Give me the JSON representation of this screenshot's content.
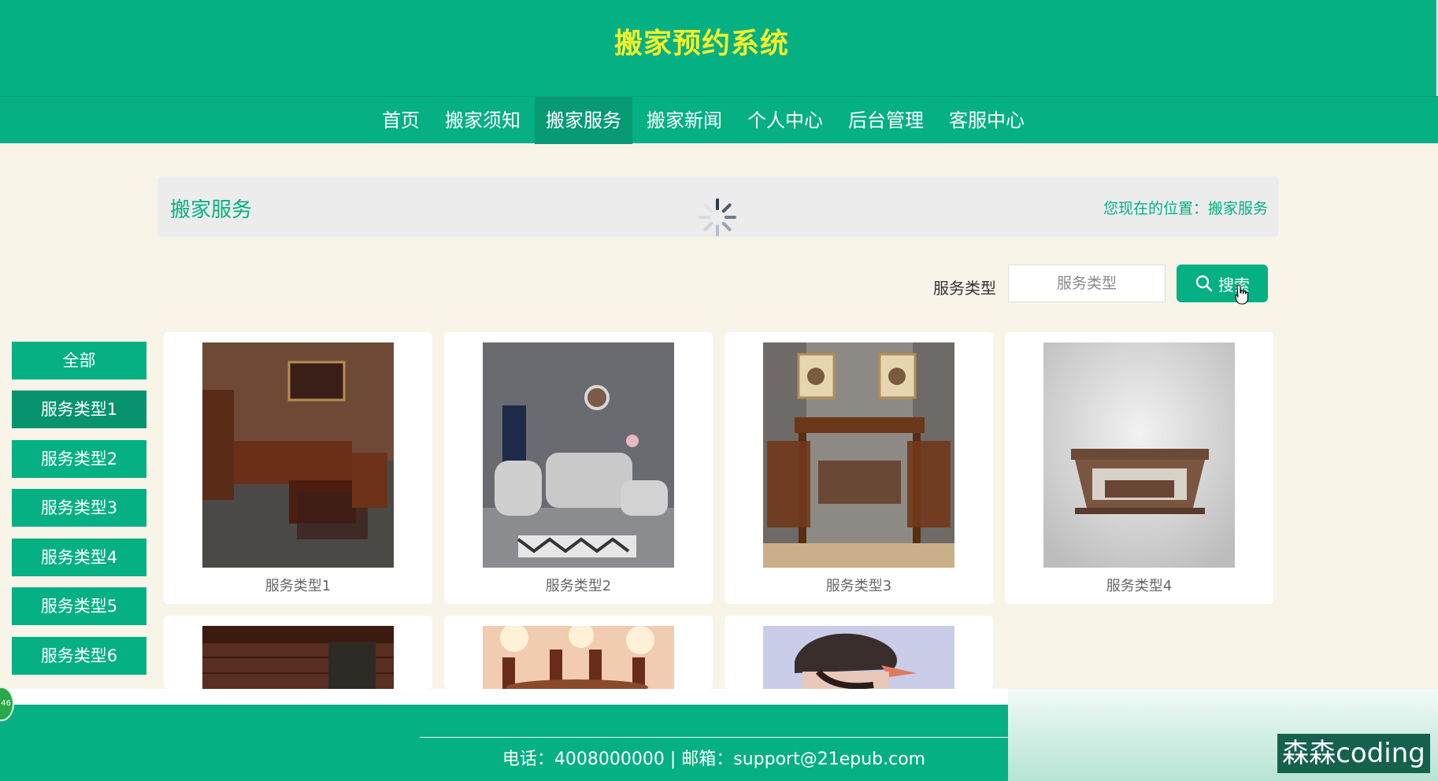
{
  "header": {
    "title": "搬家预约系统"
  },
  "nav": {
    "items": [
      {
        "label": "首页"
      },
      {
        "label": "搬家须知"
      },
      {
        "label": "搬家服务",
        "active": true
      },
      {
        "label": "搬家新闻"
      },
      {
        "label": "个人中心"
      },
      {
        "label": "后台管理"
      },
      {
        "label": "客服中心"
      }
    ]
  },
  "page": {
    "title": "搬家服务",
    "breadcrumb": "您现在的位置：搬家服务"
  },
  "search": {
    "label": "服务类型",
    "placeholder": "服务类型",
    "button_label": "搜索"
  },
  "sidebar": {
    "items": [
      {
        "label": "全部"
      },
      {
        "label": "服务类型1",
        "active": true
      },
      {
        "label": "服务类型2"
      },
      {
        "label": "服务类型3"
      },
      {
        "label": "服务类型4"
      },
      {
        "label": "服务类型5"
      },
      {
        "label": "服务类型6"
      }
    ]
  },
  "cards": [
    {
      "label": "服务类型1"
    },
    {
      "label": "服务类型2"
    },
    {
      "label": "服务类型3"
    },
    {
      "label": "服务类型4"
    },
    {
      "label": ""
    },
    {
      "label": ""
    },
    {
      "label": ""
    }
  ],
  "footer": {
    "contact": "电话：4008000000 | 邮箱：support@21epub.com"
  },
  "overlay": {
    "watermark": "森森coding",
    "badge": "46"
  },
  "colors": {
    "primary": "#05b083",
    "active": "#079a73",
    "title": "#f3ef2c",
    "background": "#f8f4e8"
  }
}
